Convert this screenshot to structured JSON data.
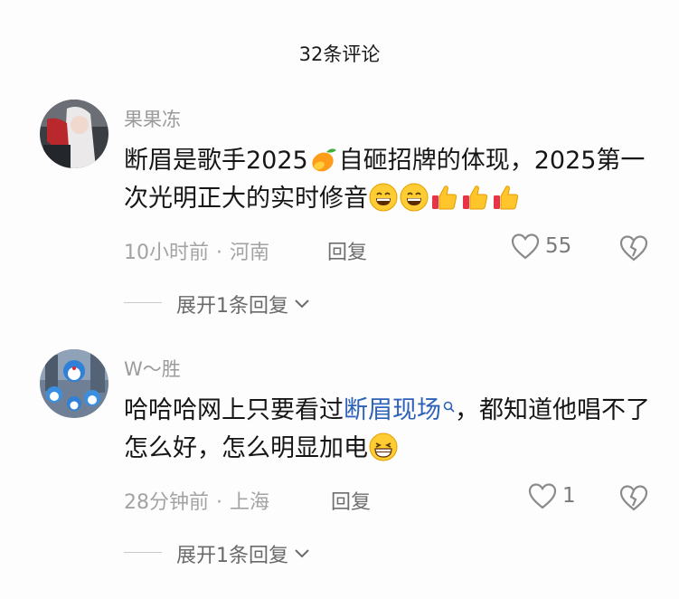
{
  "header": {
    "title": "32条评论"
  },
  "comments": [
    {
      "username": "果果冻",
      "text_part1": "断眉是歌手2025",
      "text_part2": "自砸招牌的体现，2025第一次光明正大的实时修音",
      "time": "10小时前",
      "location": "河南",
      "reply_label": "回复",
      "like_count": "55",
      "expand_label": "展开1条回复",
      "emoji_icons": [
        "mango-icon",
        "grin-icon",
        "grin-icon",
        "thumbs-up-icon",
        "thumbs-up-icon",
        "thumbs-up-icon"
      ]
    },
    {
      "username": "W～胜",
      "text_part1": "哈哈哈网上只要看过",
      "search_link": "断眉现场",
      "text_part2": "，都知道他唱不了怎么好，怎么明显加电",
      "time": "28分钟前",
      "location": "上海",
      "reply_label": "回复",
      "like_count": "1",
      "expand_label": "展开1条回复",
      "emoji_icons": [
        "laughing-icon"
      ]
    }
  ],
  "separator": "·",
  "colors": {
    "link": "#2e62b8",
    "muted": "#a3a3a3",
    "text": "#161616"
  }
}
